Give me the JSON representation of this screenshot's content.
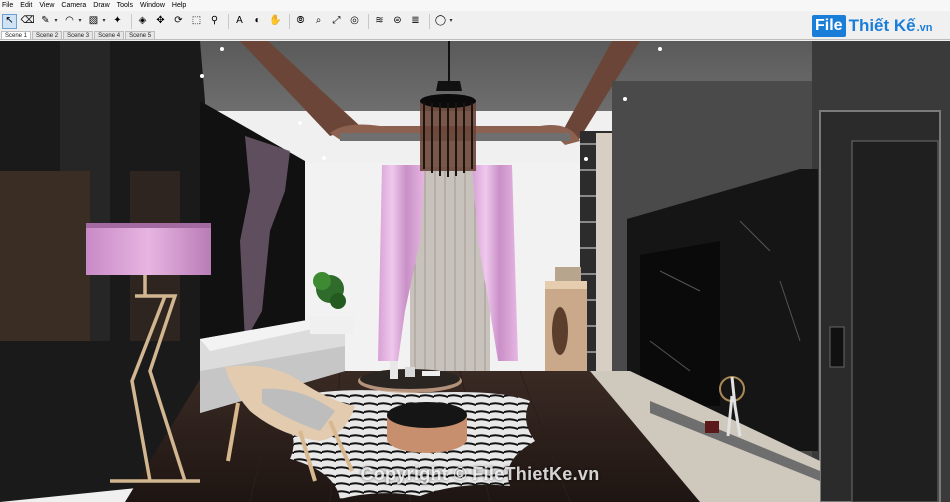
{
  "menu": [
    "File",
    "Edit",
    "View",
    "Camera",
    "Draw",
    "Tools",
    "Window",
    "Help"
  ],
  "toolbar": {
    "tools": [
      {
        "glyph": "↖",
        "active": true
      },
      {
        "glyph": "⌫"
      },
      {
        "glyph": "✎",
        "dd": true
      },
      {
        "glyph": "◠",
        "dd": true
      },
      {
        "glyph": "▧",
        "dd": true
      },
      {
        "glyph": "✦",
        "sep": true
      },
      {
        "glyph": "◈"
      },
      {
        "glyph": "✥"
      },
      {
        "glyph": "⟳"
      },
      {
        "glyph": "⬚"
      },
      {
        "glyph": "⚲",
        "sep": true
      },
      {
        "glyph": "A"
      },
      {
        "glyph": "◐"
      },
      {
        "glyph": "✋",
        "sep": true
      },
      {
        "glyph": "⦾"
      },
      {
        "glyph": "⌕"
      },
      {
        "glyph": "⤢"
      },
      {
        "glyph": "◎",
        "sep": true
      },
      {
        "glyph": "≋"
      },
      {
        "glyph": "⊜"
      },
      {
        "glyph": "≣",
        "sep": true
      },
      {
        "glyph": "◯",
        "dd": true
      }
    ]
  },
  "scenes": [
    "Scene 1",
    "Scene 2",
    "Scene 3",
    "Scene 4",
    "Scene 5"
  ],
  "selected_scene": 0,
  "logo": {
    "box": "File",
    "text": "Thiết Kế",
    "suffix": ".vn"
  },
  "watermark": "Copyright © FileThietKe.vn"
}
